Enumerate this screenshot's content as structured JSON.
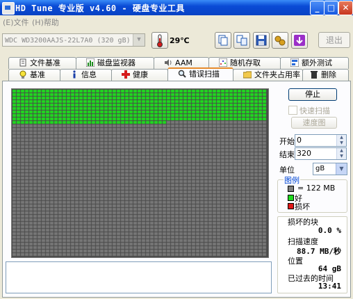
{
  "window": {
    "title": "HD Tune 专业版 v4.60 - 硬盘专业工具",
    "minimize": "_",
    "maximize": "□",
    "close": "✕"
  },
  "menu": {
    "file": "(E)文件",
    "help": "(H)帮助"
  },
  "toolbar": {
    "drive": "WDC WD3200AAJS-22L7A0 (320 gB)",
    "drive_arrow": "▼",
    "temperature": "29℃",
    "exit_label": "退出",
    "icons": [
      "thermometer-icon",
      "copy-icon",
      "copy-all-icon",
      "save-icon",
      "options-icon",
      "download-icon"
    ]
  },
  "tabs_row1": [
    {
      "label": "文件基准",
      "icon": "file-benchmark-icon"
    },
    {
      "label": "磁盘监视器",
      "icon": "disk-monitor-icon"
    },
    {
      "label": "AAM",
      "icon": "speaker-icon"
    },
    {
      "label": "随机存取",
      "icon": "random-access-icon"
    },
    {
      "label": "额外测试",
      "icon": "extra-tests-icon"
    }
  ],
  "tabs_row2": [
    {
      "label": "基准",
      "icon": "benchmark-icon"
    },
    {
      "label": "信息",
      "icon": "info-icon"
    },
    {
      "label": "健康",
      "icon": "health-icon"
    },
    {
      "label": "错误扫描",
      "icon": "magnifier-icon",
      "active": true
    },
    {
      "label": "文件夹占用率",
      "icon": "folder-icon"
    },
    {
      "label": "删除",
      "icon": "trash-icon"
    }
  ],
  "controls": {
    "stop_label": "停止",
    "quick_scan_label": "快速扫描",
    "speed_map_label": "速度图",
    "start_label": "开始",
    "start_value": "0",
    "end_label": "结束",
    "end_value": "320",
    "unit_label": "单位",
    "unit_value": "gB"
  },
  "legend": {
    "title": "图例",
    "block_size": "= 122 MB",
    "good": "好",
    "bad": "损坏",
    "colors": {
      "block": "#7f7f7f",
      "good": "#1fd91f",
      "bad": "#e01818"
    }
  },
  "stats": {
    "damaged_label": "损坏的块",
    "damaged_value": "0.0 %",
    "speed_label": "扫描速度",
    "speed_value": "88.7 MB/秒",
    "position_label": "位置",
    "position_value": "64 gB",
    "elapsed_label": "已过去的时间",
    "elapsed_value": "13:41"
  },
  "scan": {
    "progress_fraction": 0.2,
    "good_color": "#1fd91f",
    "pending_color": "#777777",
    "grid_line_color": "#4a4a4a"
  }
}
